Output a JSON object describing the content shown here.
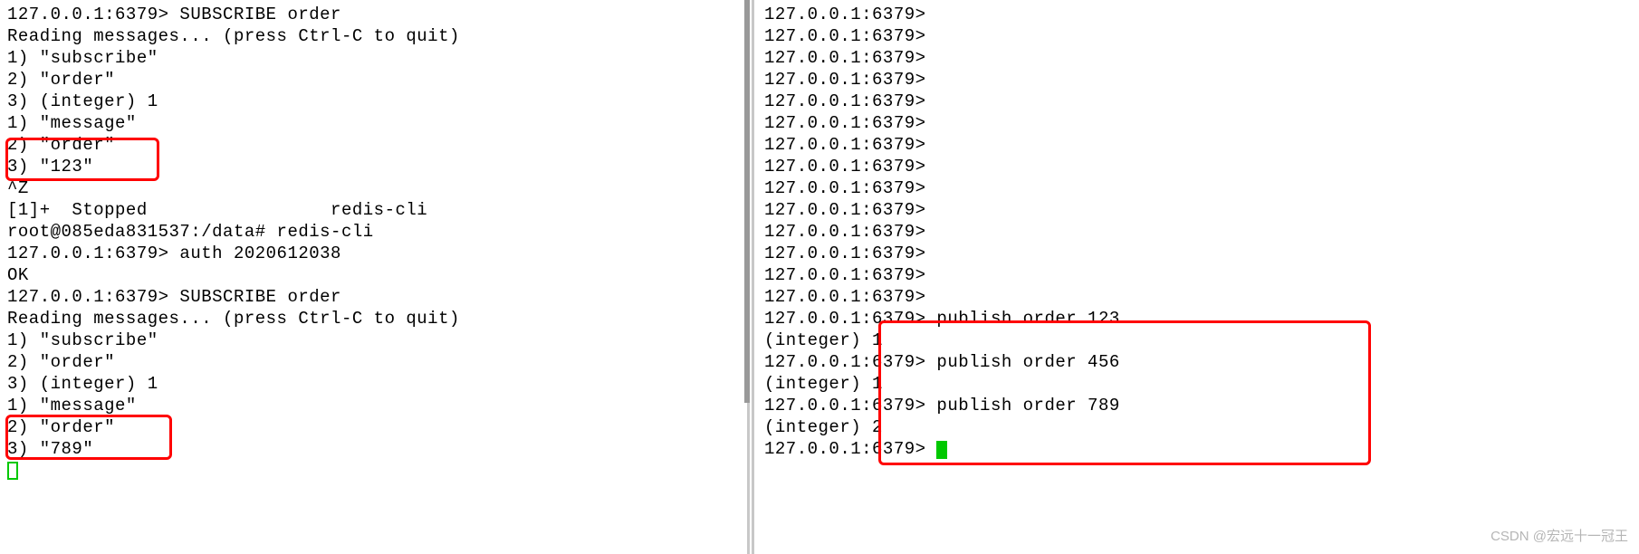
{
  "left": {
    "lines": [
      "127.0.0.1:6379> SUBSCRIBE order",
      "Reading messages... (press Ctrl-C to quit)",
      "1) \"subscribe\"",
      "2) \"order\"",
      "3) (integer) 1",
      "1) \"message\"",
      "2) \"order\"",
      "3) \"123\"",
      "^Z",
      "[1]+  Stopped                 redis-cli",
      "root@085eda831537:/data# redis-cli",
      "127.0.0.1:6379> auth 2020612038",
      "OK",
      "127.0.0.1:6379> SUBSCRIBE order",
      "Reading messages... (press Ctrl-C to quit)",
      "1) \"subscribe\"",
      "2) \"order\"",
      "3) (integer) 1",
      "1) \"message\"",
      "2) \"order\"",
      "3) \"789\""
    ]
  },
  "right": {
    "prompt_lines": [
      "127.0.0.1:6379>",
      "127.0.0.1:6379>",
      "127.0.0.1:6379>",
      "127.0.0.1:6379>",
      "127.0.0.1:6379>",
      "127.0.0.1:6379>",
      "127.0.0.1:6379>",
      "127.0.0.1:6379>",
      "127.0.0.1:6379>",
      "127.0.0.1:6379>",
      "127.0.0.1:6379>",
      "127.0.0.1:6379>",
      "127.0.0.1:6379>",
      "127.0.0.1:6379>"
    ],
    "cmd1": "127.0.0.1:6379> publish order 123",
    "result1": "(integer) 1",
    "cmd2": "127.0.0.1:6379> publish order 456",
    "result2": "(integer) 1",
    "cmd3": "127.0.0.1:6379> publish order 789",
    "result3": "(integer) 2",
    "last_prompt": "127.0.0.1:6379> "
  },
  "watermark": "CSDN @宏远十一冠王"
}
